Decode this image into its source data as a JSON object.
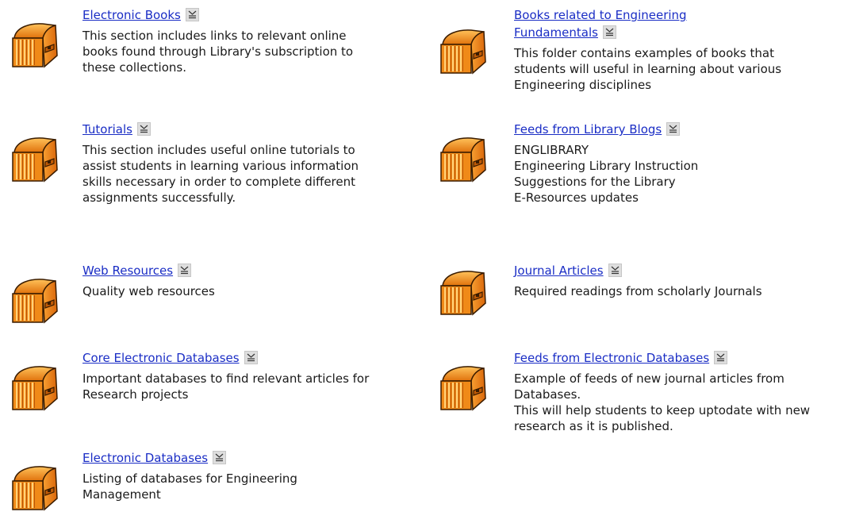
{
  "icons": {
    "folder": "treasure-chest-folder-icon",
    "menu": "action-menu-icon"
  },
  "colors": {
    "link": "#1a2dc5",
    "chest_body": "#f08a18",
    "chest_stripe": "#ffd27a",
    "chest_outline": "#3a1c00"
  },
  "left_column": [
    {
      "title": "Electronic Books",
      "description": "This section includes links to relevant online books found through Library's subscription to these collections."
    },
    {
      "title": "Tutorials",
      "description": "This section includes useful online tutorials to assist students in learning various information skills necessary in order to complete different assignments successfully."
    },
    {
      "title": "Web Resources",
      "description": "Quality web resources"
    },
    {
      "title": "Core Electronic Databases",
      "description": "Important databases to find relevant articles for Research projects"
    },
    {
      "title": "Electronic Databases",
      "description": "Listing of databases for Engineering Management"
    }
  ],
  "right_column": [
    {
      "title": "Books related to Engineering Fundamentals",
      "description": "This folder contains examples of books that students will useful in learning about various Engineering disciplines"
    },
    {
      "title": "Feeds from Library Blogs",
      "description_lines": [
        "ENGLIBRARY",
        "Engineering Library Instruction",
        "Suggestions for the Library",
        "E-Resources updates"
      ]
    },
    {
      "title": "Journal Articles",
      "description": "Required readings from scholarly Journals"
    },
    {
      "title": "Feeds from Electronic Databases",
      "description_lines": [
        "Example of feeds of new journal articles from Databases.",
        "This will help students to keep uptodate with new research as it is published."
      ]
    }
  ]
}
